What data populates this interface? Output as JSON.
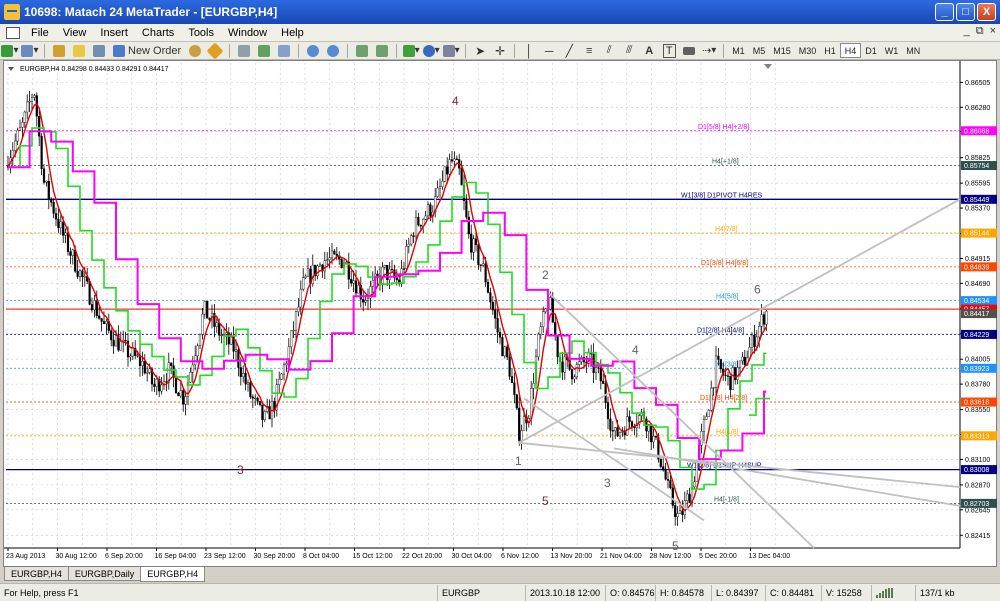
{
  "window": {
    "title": "10698: Matach 24 MetaTrader - [EURGBP,H4]",
    "minimize": "_",
    "maximize": "□",
    "close": "X"
  },
  "menu": {
    "items": [
      "File",
      "View",
      "Insert",
      "Charts",
      "Tools",
      "Window",
      "Help"
    ],
    "mdi_controls": [
      "_",
      "⧉",
      "×"
    ]
  },
  "toolbar": {
    "new_order_label": "New Order",
    "timeframes": [
      "M1",
      "M5",
      "M15",
      "M30",
      "H1",
      "H4",
      "D1",
      "W1",
      "MN"
    ],
    "active_timeframe": "H4"
  },
  "chart_data": {
    "type": "candlestick",
    "info": "EURGBP,H4  0.84298 0.84433 0.84291 0.84417",
    "price_axis": [
      "0.86505",
      "0.86280",
      "0.86060",
      "0.85825",
      "0.85595",
      "0.85370",
      "0.85140",
      "0.84915",
      "0.84690",
      "0.84460",
      "0.84235",
      "0.84005",
      "0.83780",
      "0.83550",
      "0.83325",
      "0.83100",
      "0.82870",
      "0.82645",
      "0.82415"
    ],
    "ylim": [
      0.823,
      0.8668
    ],
    "time_axis": [
      "23 Aug 2013",
      "30 Aug 12:00",
      "6 Sep 20:00",
      "16 Sep 04:00",
      "23 Sep 12:00",
      "30 Sep 20:00",
      "8 Oct 04:00",
      "15 Oct 12:00",
      "22 Oct 20:00",
      "30 Oct 04:00",
      "6 Nov 12:00",
      "13 Nov 20:00",
      "21 Nov 04:00",
      "28 Nov 12:00",
      "5 Dec 20:00",
      "13 Dec 04:00"
    ],
    "price_markers": [
      {
        "value": "0.86068",
        "color": "#ff00ff"
      },
      {
        "value": "0.85754",
        "color": "#2f4f4f"
      },
      {
        "value": "0.85449",
        "color": "#000080"
      },
      {
        "value": "0.85144",
        "color": "#ffa500"
      },
      {
        "value": "0.84839",
        "color": "#ff4500"
      },
      {
        "value": "0.84534",
        "color": "#1e90ff"
      },
      {
        "value": "0.84457",
        "color": "#ff0000"
      },
      {
        "value": "0.84417",
        "color": "#505050"
      },
      {
        "value": "0.84229",
        "color": "#000080"
      },
      {
        "value": "0.83923",
        "color": "#1e90ff"
      },
      {
        "value": "0.83618",
        "color": "#ff4500"
      },
      {
        "value": "0.83313",
        "color": "#ffa500"
      },
      {
        "value": "0.83008",
        "color": "#000080"
      },
      {
        "value": "0.82703",
        "color": "#2f4f4f"
      }
    ],
    "level_labels": [
      {
        "text": "D1[5/8] H4[+2/8]",
        "price": 0.86068,
        "color": "#ff00ff"
      },
      {
        "text": "H4[+1/8]",
        "price": 0.85754,
        "color": "#2f4f4f"
      },
      {
        "text": "W1[3/8] D1PIVOT H4RES",
        "price": 0.85449,
        "color": "#000080"
      },
      {
        "text": "H4[7/8]",
        "price": 0.85144,
        "color": "#ffa500"
      },
      {
        "text": "D1[3/8] H4[6/8]",
        "price": 0.84839,
        "color": "#ff4500"
      },
      {
        "text": "H4[5/8]",
        "price": 0.84534,
        "color": "#1e90ff"
      },
      {
        "text": "D1[2/8] H4[4/8]",
        "price": 0.84229,
        "color": "#000080"
      },
      {
        "text": "H4[3/8]",
        "price": 0.83923,
        "color": "#1e90ff"
      },
      {
        "text": "D1[1/8] H4[2/8]",
        "price": 0.83618,
        "color": "#ff4500"
      },
      {
        "text": "H4[1/8]",
        "price": 0.83313,
        "color": "#ffa500"
      },
      {
        "text": "W1[2/8] D1SUP H4SUP",
        "price": 0.83008,
        "color": "#000080"
      },
      {
        "text": "H4[-1/8]",
        "price": 0.82703,
        "color": "#2f4f4f"
      }
    ],
    "wave_labels": [
      "4",
      "3",
      "2",
      "1",
      "4",
      "5",
      "3",
      "6",
      "5"
    ]
  },
  "tabs": [
    "EURGBP,H4",
    "EURGBP,Daily",
    "EURGBP,H4"
  ],
  "active_tab": 2,
  "status": {
    "help": "For Help, press F1",
    "symbol": "EURGBP",
    "time": "2013.10.18 12:00",
    "open": "O: 0.84576",
    "high": "H: 0.84578",
    "low": "L: 0.84397",
    "close": "C: 0.84481",
    "volume": "V: 15258",
    "traffic": "137/1 kb"
  }
}
